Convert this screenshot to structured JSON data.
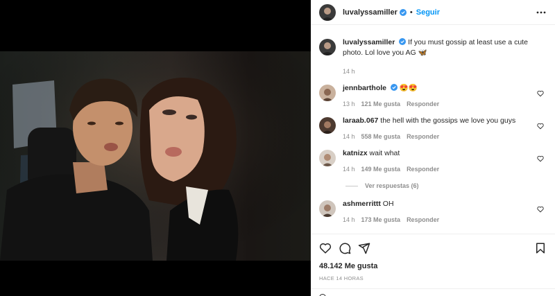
{
  "post": {
    "author": "luvalyssamiller",
    "follow_label": "Seguir",
    "separator": "•",
    "caption": "If you must gossip at least use a cute photo. Lol love you AG 🦋",
    "caption_time": "14 h",
    "likes": "48.142 Me gusta",
    "posted_ago": "HACE 14 HORAS"
  },
  "comments": [
    {
      "user": "jennbarthole",
      "verified": true,
      "text": "😍😍",
      "time": "13 h",
      "likes": "121 Me gusta",
      "reply_label": "Responder"
    },
    {
      "user": "laraab.067",
      "verified": false,
      "text": "the hell with the gossips we love you guys",
      "time": "14 h",
      "likes": "558 Me gusta",
      "reply_label": "Responder"
    },
    {
      "user": "katnizx",
      "verified": false,
      "text": "wait what",
      "time": "14 h",
      "likes": "149 Me gusta",
      "reply_label": "Responder",
      "view_replies": "Ver respuestas (6)"
    },
    {
      "user": "ashmerrittt",
      "verified": false,
      "text": "OH",
      "time": "14 h",
      "likes": "173 Me gusta",
      "reply_label": "Responder"
    }
  ],
  "icons": {
    "more": "more-options-icon",
    "like": "heart-icon",
    "comment": "comment-icon",
    "share": "share-icon",
    "save": "bookmark-icon",
    "verified": "verified-badge-icon"
  },
  "colors": {
    "link": "#0095f6",
    "verified": "#3897f0",
    "muted": "#8e8e8e",
    "text": "#262626"
  }
}
